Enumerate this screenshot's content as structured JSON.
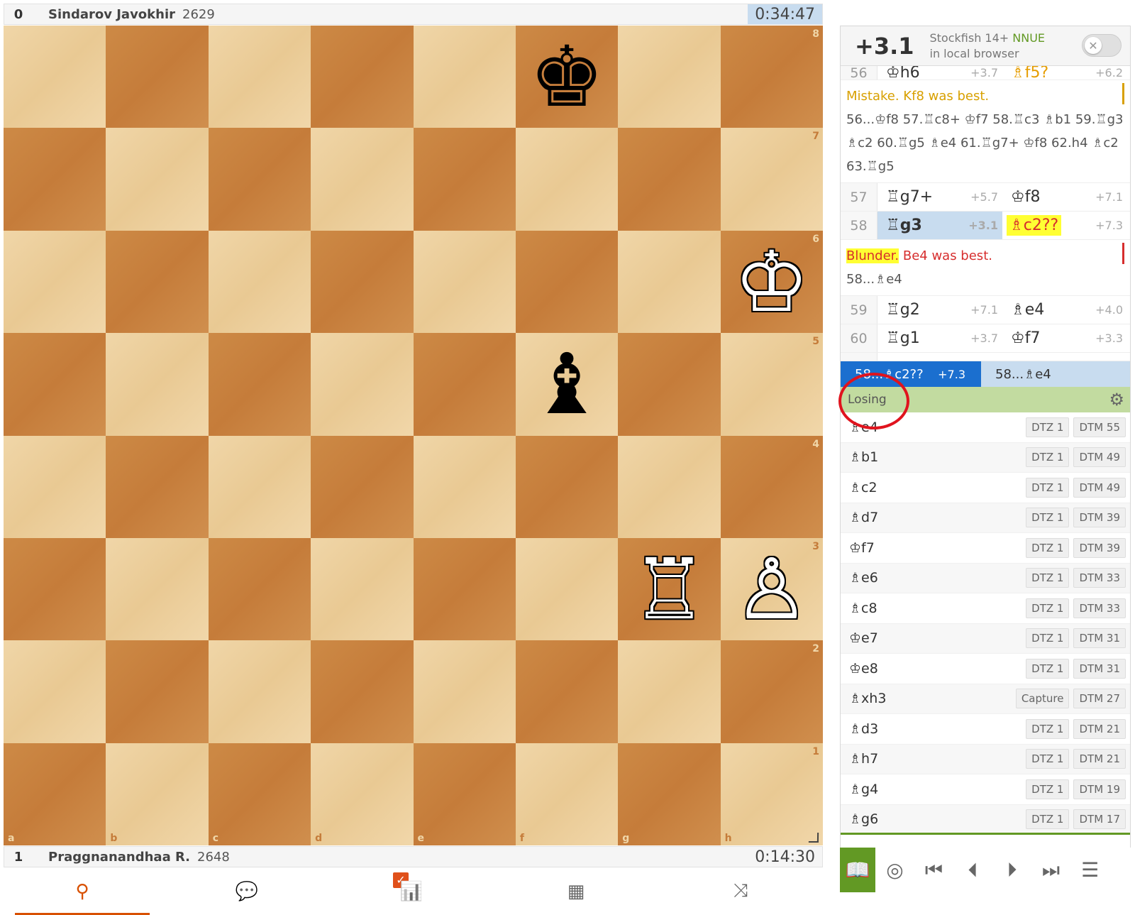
{
  "top_player": {
    "score": "0",
    "name": "Sindarov Javokhir",
    "rating": "2629",
    "clock": "0:34:47"
  },
  "bottom_player": {
    "score": "1",
    "name": "Praggnanandhaa R.",
    "rating": "2648",
    "clock": "0:14:30"
  },
  "board": {
    "ranks": [
      "8",
      "7",
      "6",
      "5",
      "4",
      "3",
      "2",
      "1"
    ],
    "files": [
      "a",
      "b",
      "c",
      "d",
      "e",
      "f",
      "g",
      "h"
    ],
    "pieces": [
      {
        "square": "f8",
        "glyph": "♚",
        "color": "black",
        "name": "black-king"
      },
      {
        "square": "h6",
        "glyph": "♔",
        "color": "white",
        "name": "white-king"
      },
      {
        "square": "f5",
        "glyph": "♝",
        "color": "black",
        "name": "black-bishop"
      },
      {
        "square": "g3",
        "glyph": "♖",
        "color": "white",
        "name": "white-rook"
      },
      {
        "square": "h3",
        "glyph": "♙",
        "color": "white",
        "name": "white-pawn"
      }
    ]
  },
  "engine": {
    "eval": "+3.1",
    "name": "Stockfish 14+",
    "nnue": "NNUE",
    "location": "in local browser"
  },
  "moves": {
    "row56": {
      "num": "56",
      "white": "♔h6",
      "white_eval": "+3.7",
      "black": "♗f5?",
      "black_eval": "+6.2"
    },
    "mistake_comment": {
      "verdict": "Mistake.",
      "text": " Kf8 was best.",
      "variation": "56...♔f8 57.♖c8+ ♔f7 58.♖c3 ♗b1 59.♖g3 ♗c2 60.♖g5 ♗e4 61.♖g7+ ♔f8 62.h4 ♗c2 63.♖g5"
    },
    "row57": {
      "num": "57",
      "white": "♖g7+",
      "white_eval": "+5.7",
      "black": "♔f8",
      "black_eval": "+7.1"
    },
    "row58": {
      "num": "58",
      "white": "♖g3",
      "white_eval": "+3.1",
      "black": "♗c2??",
      "black_eval": "+7.3"
    },
    "blunder_comment": {
      "verdict": "Blunder.",
      "text": " Be4 was best.",
      "variation": "58...♗e4"
    },
    "row59": {
      "num": "59",
      "white": "♖g2",
      "white_eval": "+7.1",
      "black": "♗e4",
      "black_eval": "+4.0"
    },
    "row60": {
      "num": "60",
      "white": "♖g1",
      "white_eval": "+3.7",
      "black": "♔f7",
      "black_eval": "+3.3"
    }
  },
  "tb_bar": {
    "left": "58...♗c2??",
    "left_eval": "+7.3",
    "right": "58...♗e4"
  },
  "tablebase": {
    "status": "Losing",
    "moves": [
      {
        "san": "♗e4",
        "a": "DTZ 1",
        "b": "DTM 55"
      },
      {
        "san": "♗b1",
        "a": "DTZ 1",
        "b": "DTM 49"
      },
      {
        "san": "♗c2",
        "a": "DTZ 1",
        "b": "DTM 49"
      },
      {
        "san": "♗d7",
        "a": "DTZ 1",
        "b": "DTM 39"
      },
      {
        "san": "♔f7",
        "a": "DTZ 1",
        "b": "DTM 39"
      },
      {
        "san": "♗e6",
        "a": "DTZ 1",
        "b": "DTM 33"
      },
      {
        "san": "♗c8",
        "a": "DTZ 1",
        "b": "DTM 33"
      },
      {
        "san": "♔e7",
        "a": "DTZ 1",
        "b": "DTM 31"
      },
      {
        "san": "♔e8",
        "a": "DTZ 1",
        "b": "DTM 31"
      },
      {
        "san": "♗xh3",
        "a": "Capture",
        "b": "DTM 27"
      },
      {
        "san": "♗d3",
        "a": "DTZ 1",
        "b": "DTM 21"
      },
      {
        "san": "♗h7",
        "a": "DTZ 1",
        "b": "DTM 21"
      },
      {
        "san": "♗g4",
        "a": "DTZ 1",
        "b": "DTM 19"
      },
      {
        "san": "♗g6",
        "a": "DTZ 1",
        "b": "DTM 17"
      }
    ]
  },
  "icons": {
    "tag": "⚲",
    "chat": "💬",
    "chart": "📊",
    "grid": "▦",
    "share": "⤨",
    "book": "📖",
    "target": "◎",
    "first": "⏮",
    "prev": "⏴",
    "next": "⏵",
    "last": "⏭",
    "menu": "☰",
    "gear": "⚙",
    "close": "✕",
    "check": "✓"
  },
  "colors": {
    "accent": "#d85000",
    "green": "#629924",
    "blue": "#1b6fcf",
    "blunder": "#d62d2d",
    "mistake": "#d8a000"
  }
}
